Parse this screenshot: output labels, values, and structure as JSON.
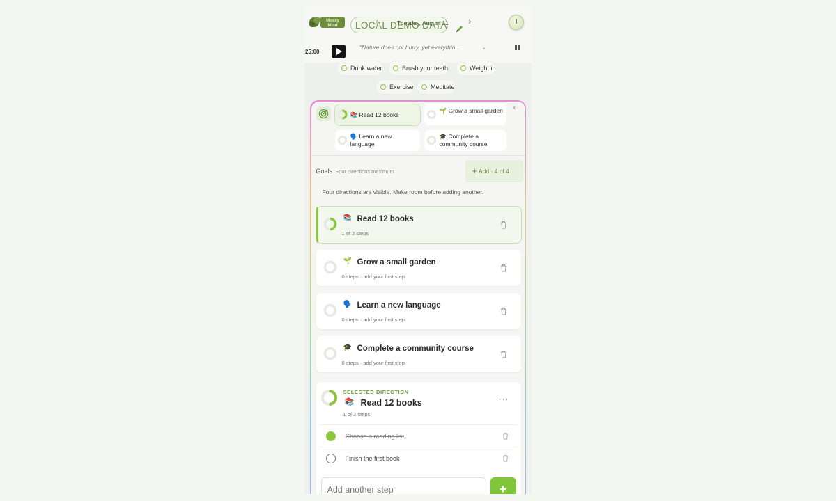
{
  "header": {
    "brand": "Mossy Mind",
    "badge": "LOCAL DEMO DATA",
    "date": "Tuesday, August 11",
    "avatar_initial": "I"
  },
  "focus": {
    "timer": "25:00",
    "quote": "\"Nature does not hurry, yet everythin...",
    "quote_dot": "•"
  },
  "habits": [
    "Drink water",
    "Brush your teeth",
    "Weight in",
    "Exercise",
    "Meditate"
  ],
  "goal_tabs": [
    {
      "emoji": "📚",
      "label": "Read 12 books",
      "active": true,
      "progress": 0.5
    },
    {
      "emoji": "🌱",
      "label": "Grow a small garden",
      "active": false,
      "progress": 0
    },
    {
      "emoji": "🗣️",
      "label": "Learn a new language",
      "active": false,
      "progress": 0
    },
    {
      "emoji": "🎓",
      "label": "Complete a community course",
      "active": false,
      "progress": 0
    }
  ],
  "goals_section": {
    "title": "Goals",
    "hint": "Four directions maximum",
    "add_label": "Add · 4 of 4",
    "notice": "Four directions are visible. Make room before adding another."
  },
  "goals": [
    {
      "emoji": "📚",
      "title": "Read 12 books",
      "subtitle": "1 of 2 steps",
      "active": true,
      "progress": 0.5
    },
    {
      "emoji": "🌱",
      "title": "Grow a small garden",
      "subtitle": "0 steps · add your first step",
      "active": false,
      "progress": 0
    },
    {
      "emoji": "🗣️",
      "title": "Learn a new language",
      "subtitle": "0 steps · add your first step",
      "active": false,
      "progress": 0
    },
    {
      "emoji": "🎓",
      "title": "Complete a community course",
      "subtitle": "0 steps · add your first step",
      "active": false,
      "progress": 0
    }
  ],
  "selected": {
    "kicker": "SELECTED DIRECTION",
    "emoji": "📚",
    "title": "Read 12 books",
    "subtitle": "1 of 2 steps",
    "progress": 0.5,
    "more": "···",
    "steps": [
      {
        "text": "Choose a reading list",
        "done": true
      },
      {
        "text": "Finish the first book",
        "done": false
      }
    ],
    "input_placeholder": "Add another step",
    "add_symbol": "+"
  },
  "colors": {
    "accent": "#8cc63f",
    "accent_dark": "#6b8f45",
    "ring_track": "#e7e7e5"
  }
}
